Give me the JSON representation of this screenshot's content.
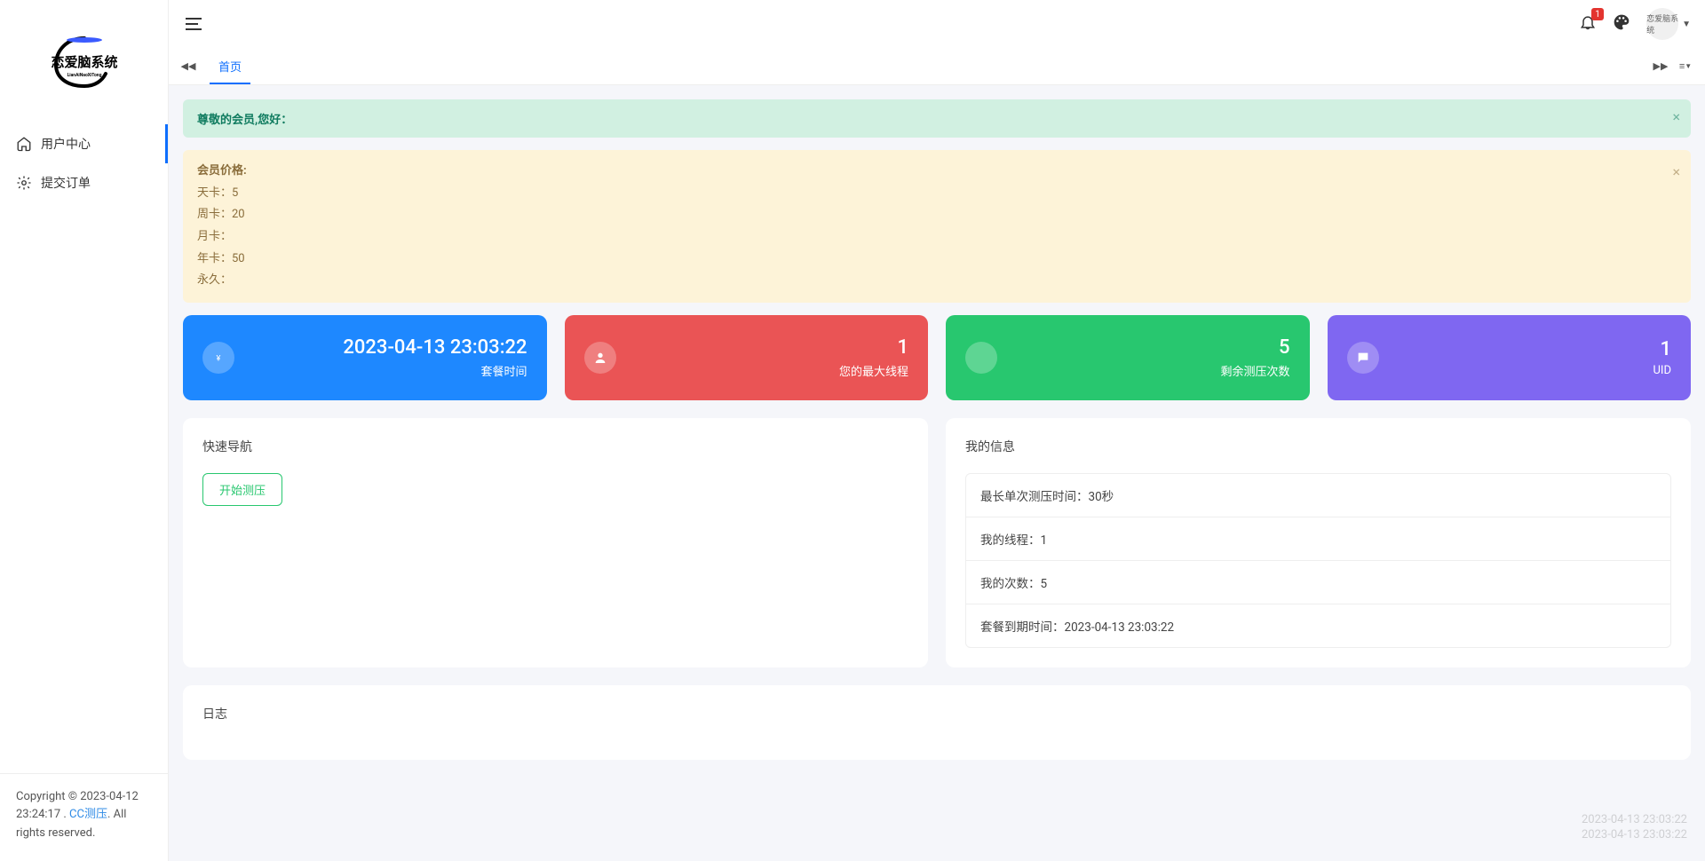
{
  "branding": {
    "logo_main": "恋爱脑系统",
    "logo_sub": "LianAiNaoXiTong",
    "avatar": "恋爱脑系统"
  },
  "sidebar": {
    "items": [
      {
        "label": "用户中心",
        "active": true
      },
      {
        "label": "提交订单",
        "active": false
      }
    ],
    "footer_prefix": "Copyright © 2023-04-12 23:24:17 . ",
    "footer_link": "CC测压",
    "footer_suffix": ". All rights reserved."
  },
  "topbar": {
    "notif_count": "1"
  },
  "tabs": {
    "home": "首页"
  },
  "alert_success": "尊敬的会员,您好：",
  "alert_price": {
    "title": "会员价格:",
    "lines": [
      "天卡：5",
      "周卡：20",
      "月卡：",
      "年卡：50",
      "永久："
    ]
  },
  "stats": [
    {
      "value": "2023-04-13 23:03:22",
      "label": "套餐时间"
    },
    {
      "value": "1",
      "label": "您的最大线程"
    },
    {
      "value": "5",
      "label": "剩余测压次数"
    },
    {
      "value": "1",
      "label": "UID"
    }
  ],
  "quicknav": {
    "title": "快速导航",
    "btn": "开始测压"
  },
  "myinfo": {
    "title": "我的信息",
    "items": [
      "最长单次测压时间：30秒",
      "我的线程：1",
      "我的次数：5",
      "套餐到期时间：2023-04-13 23:03:22"
    ]
  },
  "log": {
    "title": "日志"
  },
  "watermark": "2023-04-13 23:03:22"
}
